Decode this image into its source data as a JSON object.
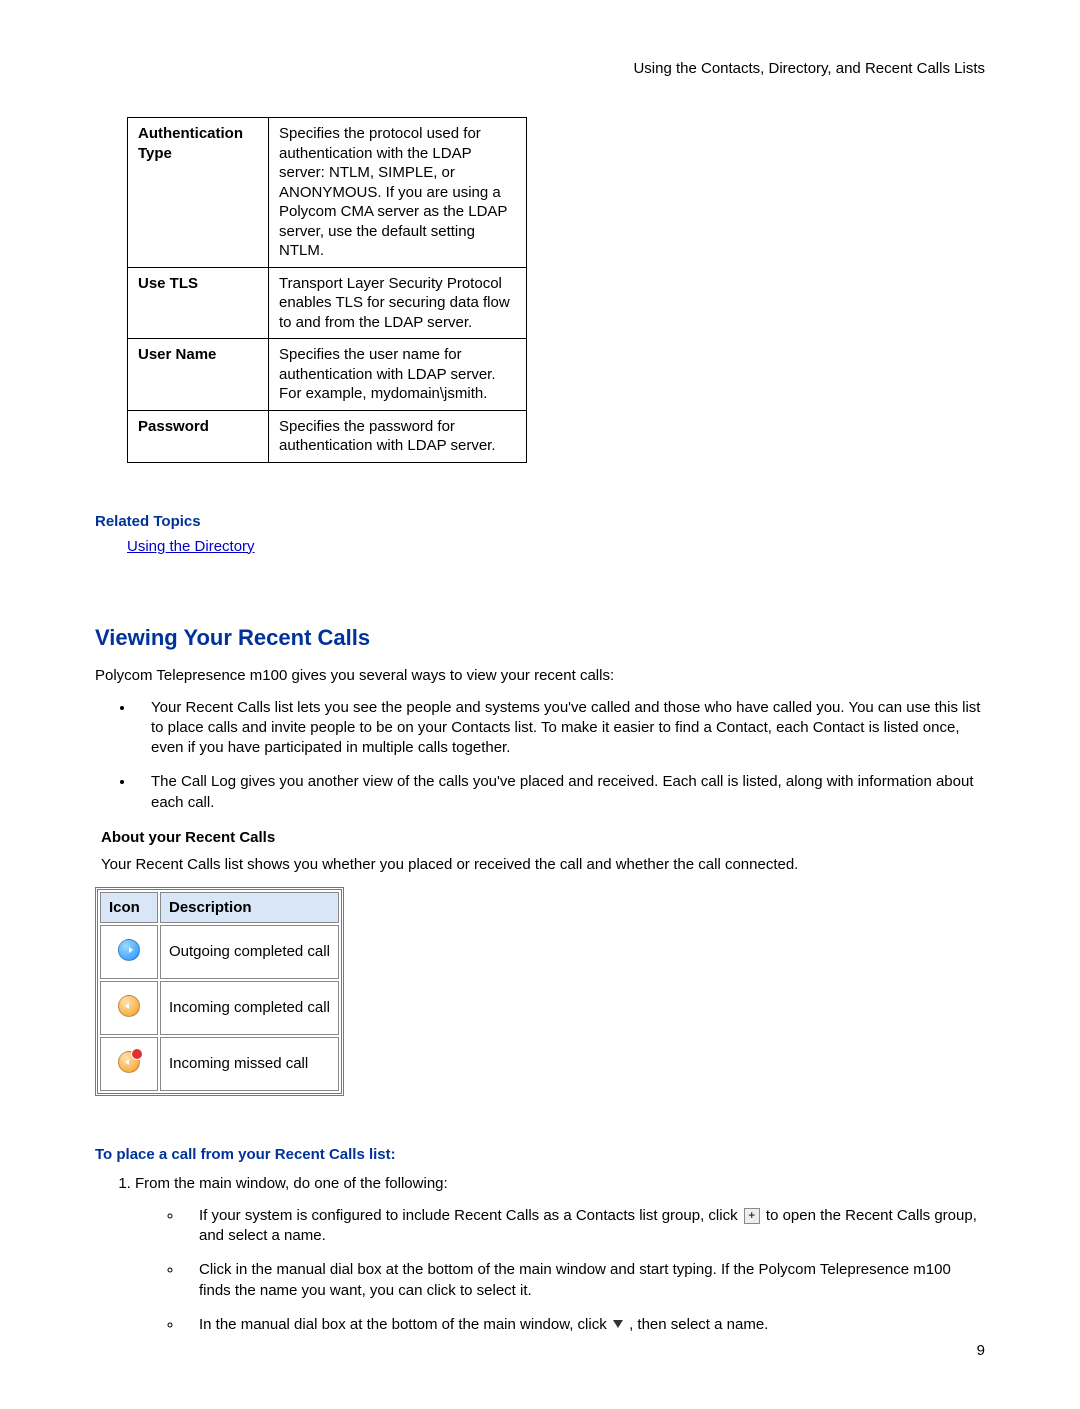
{
  "header": {
    "chapter": "Using the Contacts, Directory, and Recent Calls Lists"
  },
  "settings_table": {
    "rows": [
      {
        "label": "Authentication Type",
        "desc": "Specifies the protocol used for authentication with the LDAP server: NTLM, SIMPLE, or ANONYMOUS. If you are using a Polycom CMA server as the LDAP server, use the default setting NTLM."
      },
      {
        "label": "Use TLS",
        "desc": "Transport Layer Security Protocol enables TLS for securing data flow to and from the LDAP server."
      },
      {
        "label": "User Name",
        "desc": "Specifies the user name for authentication with LDAP server. For example, mydomain\\jsmith."
      },
      {
        "label": "Password",
        "desc": "Specifies the password for authentication with LDAP server."
      }
    ]
  },
  "related": {
    "heading": "Related Topics",
    "link_text": "Using the Directory"
  },
  "section": {
    "title": "Viewing Your Recent Calls",
    "intro": "Polycom Telepresence m100 gives you several ways to view your recent calls:",
    "bullets": [
      "Your Recent Calls list lets you see the people and systems you've called and those who have called you. You can use this list to place calls and invite people to be on your Contacts list. To make it easier to find a Contact, each Contact is listed once, even if you have participated in multiple calls together.",
      "The Call Log gives you another view of the calls you've placed and received. Each call is listed, along with information about each call."
    ],
    "about_heading": "About your Recent Calls",
    "about_text": "Your Recent Calls list shows you whether you placed or received the call and whether the call connected."
  },
  "icon_table": {
    "headers": {
      "icon": "Icon",
      "desc": "Description"
    },
    "rows": [
      {
        "icon": "outgoing-completed",
        "desc": "Outgoing completed call"
      },
      {
        "icon": "incoming-completed",
        "desc": "Incoming completed call"
      },
      {
        "icon": "incoming-missed",
        "desc": "Incoming missed call"
      }
    ]
  },
  "procedure": {
    "heading": "To place a call from your Recent Calls list:",
    "step1": "From the main window, do one of the following:",
    "sub": {
      "a_pre": "If your system is configured to include Recent Calls as a Contacts list group, click ",
      "a_post": "to open the Recent Calls group, and select a name.",
      "b": "Click in the manual dial box at the bottom of the main window and start typing. If the Polycom Telepresence m100 finds the name you want, you can click to select it.",
      "c_pre": "In the manual dial box at the bottom of the main window, click ",
      "c_post": ", then select a name."
    }
  },
  "page_number": "9"
}
